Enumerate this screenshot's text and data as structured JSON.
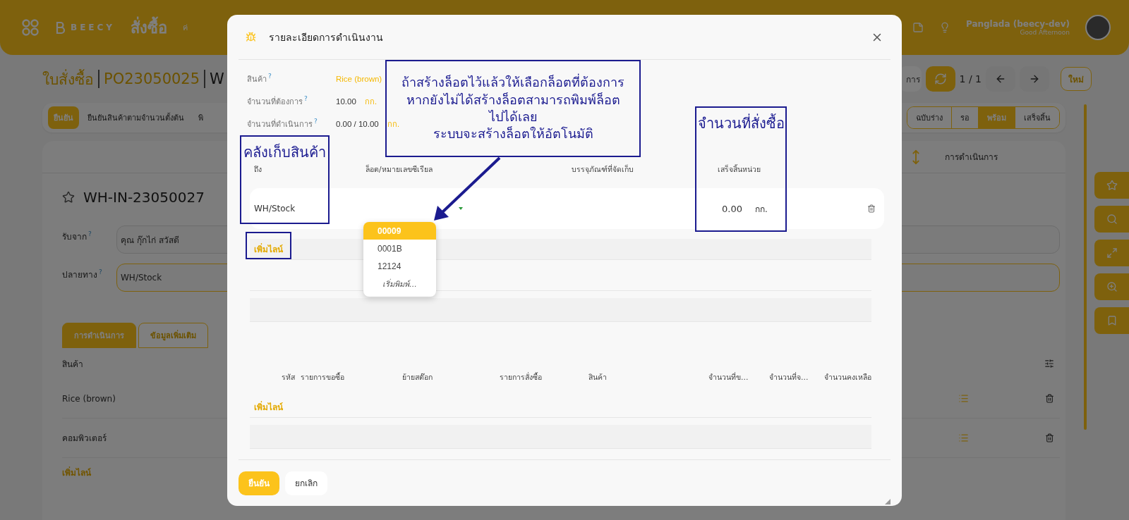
{
  "header": {
    "logo": "BEECY",
    "app_title": "สั่งซื้อ",
    "nav_items": [
      "ค่"
    ],
    "user_name": "Panglada (beecy-dev)",
    "greeting": "Good Afternoon"
  },
  "breadcrumb": [
    {
      "text": "ใบสั่งซื้อ",
      "kind": "link"
    },
    {
      "text": "PO23050025",
      "kind": "link"
    },
    {
      "text": "W",
      "kind": "current"
    }
  ],
  "pager": {
    "action": "การ",
    "count": "1 / 1",
    "new_button": "ใหม่"
  },
  "action_buttons": [
    {
      "label": "ยืนยัน",
      "primary": true
    },
    {
      "label": "ยืนยันสินค้าตามจำนวนตั้งต้น",
      "primary": false
    },
    {
      "label": "พิ",
      "primary": false
    }
  ],
  "statuses": [
    {
      "label": "ฉบับร่าง",
      "selected": false
    },
    {
      "label": "รอ",
      "selected": false
    },
    {
      "label": "พร้อม",
      "selected": true
    },
    {
      "label": "เสร็จสิ้น",
      "selected": false
    }
  ],
  "record": {
    "smart_button": "การดำเนินการ",
    "starred": false,
    "name": "WH-IN-23050027",
    "fields": [
      {
        "label": "รับจาก",
        "help": "?",
        "value": "คุณ กุ๊กไก่ สวัสดี",
        "focused": false
      },
      {
        "label": "ปลายทาง",
        "help": "?",
        "value": "WH/Stock",
        "focused": true
      }
    ],
    "tabs": [
      {
        "label": "การดำเนินการ",
        "selected": true
      },
      {
        "label": "ข้อมูลเพิ่มเติม",
        "selected": false
      }
    ],
    "table": {
      "column": "สินค้า",
      "rows": [
        "Rice (brown)",
        "คอมพิวเตอร์"
      ],
      "add_line": "เพิ่มไลน์"
    }
  },
  "modal": {
    "title": "รายละเอียดการดำเนินงาน",
    "info": [
      {
        "label": "สินค้า",
        "help": "?",
        "value": "Rice (brown)",
        "kind": "link"
      },
      {
        "label": "จำนวนที่ต้องการ",
        "help": "?",
        "value": "10.00",
        "unit": "กก.",
        "kind": "quantity"
      },
      {
        "label": "จำนวนที่ดำเนินการ",
        "help": "?",
        "value": "0.00 / 10.00",
        "unit": "กก.",
        "kind": "quantity"
      }
    ],
    "move_lines": {
      "columns": [
        "ถึง",
        "ล็อต/หมายเลขซีเรียล",
        "บรรจุภัณฑ์ที่จัดเก็บ",
        "เสร็จสิ้น",
        "หน่วย"
      ],
      "rows": [
        {
          "to": "WH/Stock",
          "done": "0.00",
          "unit": "กก."
        }
      ],
      "lot_options": [
        {
          "label": "00009",
          "selected": true
        },
        {
          "label": "0001B",
          "selected": false
        },
        {
          "label": "12124",
          "selected": false
        }
      ],
      "lot_hint": "เริ่มพิมพ์...",
      "add_line": "เพิ่มไลน์"
    },
    "lines_table": {
      "columns": [
        "รหัส",
        "รายการขอซื้อ",
        "ย้ายสต๊อก",
        "รายการสั่งซื้อ",
        "สินค้า",
        "จำนวนที่ข…",
        "จำนวนที่จ…",
        "จำนวนคงเหลือ"
      ],
      "add_line": "เพิ่มไลน์"
    },
    "buttons": [
      {
        "label": "ยืนยัน",
        "primary": true
      },
      {
        "label": "ยกเลิก",
        "primary": false
      }
    ]
  },
  "annotations": [
    {
      "kind": "label-box",
      "text": "คลังเก็บสินค้า"
    },
    {
      "kind": "callout",
      "text": "ถ้าสร้างล็อตไว้แล้วให้เลือกล็อตที่ต้องการ\nหากยังไม่ได้สร้างล็อตสามารถพิมพ์ล็อต\nไปได้เลย\nระบบจะสร้างล็อตให้อัตโนมัติ"
    },
    {
      "kind": "label-box",
      "text": "จำนวนที่สั่งซื้อ"
    },
    {
      "kind": "outline"
    },
    {
      "kind": "arrow"
    }
  ]
}
